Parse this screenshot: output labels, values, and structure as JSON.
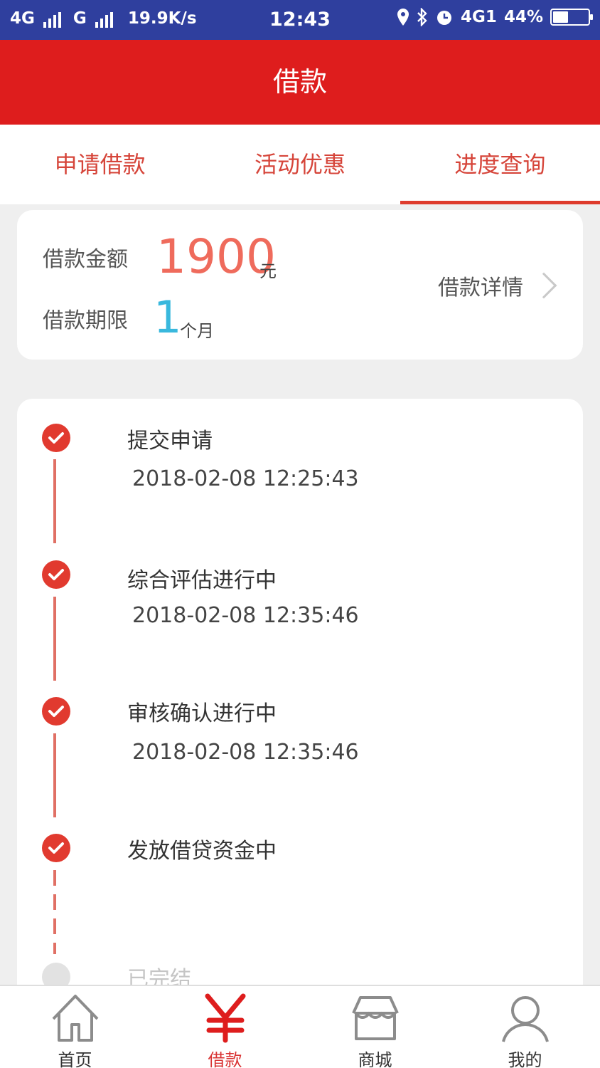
{
  "status_bar": {
    "left_text": "4G",
    "g_label": "G",
    "speed": "19.9K/s",
    "time": "12:43",
    "net_badge": "4G1",
    "battery": "44%",
    "battery_level": 0.44,
    "icons": [
      "location-icon",
      "bluetooth-icon",
      "alarm-icon"
    ]
  },
  "header": {
    "title": "借款"
  },
  "tabs": [
    {
      "label": "申请借款",
      "active": false
    },
    {
      "label": "活动优惠",
      "active": false
    },
    {
      "label": "进度查询",
      "active": true
    }
  ],
  "summary": {
    "amount_label": "借款金额",
    "amount_value": "1900",
    "amount_unit": "元",
    "term_label": "借款期限",
    "term_value": "1",
    "term_unit": "个月",
    "details_link": "借款详情"
  },
  "timeline": [
    {
      "title": "提交申请",
      "time": "2018-02-08 12:25:43",
      "done": true
    },
    {
      "title": "综合评估进行中",
      "time": "2018-02-08 12:35:46",
      "done": true
    },
    {
      "title": "审核确认进行中",
      "time": "2018-02-08 12:35:46",
      "done": true
    },
    {
      "title": "发放借贷资金中",
      "time": "",
      "done": true
    },
    {
      "title": "已完结",
      "time": "",
      "done": false
    }
  ],
  "bottom_nav": [
    {
      "label": "首页",
      "icon": "home-icon",
      "active": false
    },
    {
      "label": "借款",
      "icon": "yuan-icon",
      "active": true
    },
    {
      "label": "商城",
      "icon": "shop-icon",
      "active": false
    },
    {
      "label": "我的",
      "icon": "user-icon",
      "active": false
    }
  ],
  "colors": {
    "brand_red": "#de1d1d",
    "status_bar": "#2f3f9e",
    "amount": "#ef6b5c",
    "term": "#39b8dd"
  }
}
